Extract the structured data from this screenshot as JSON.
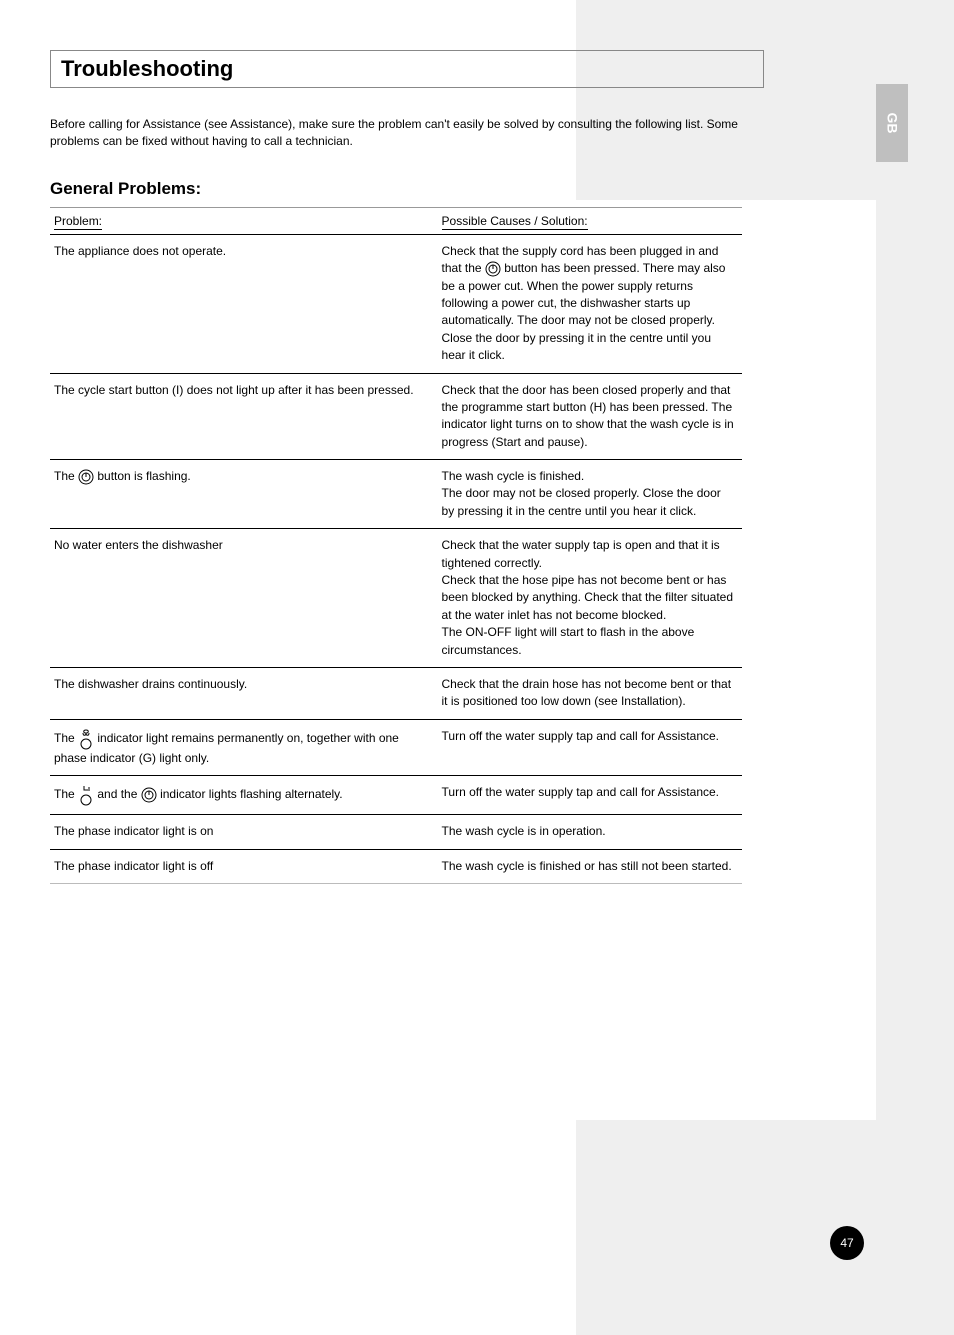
{
  "side_tab": "GB",
  "title": "Troubleshooting",
  "intro": "Before calling for Assistance (see Assistance), make sure the problem can't easily be solved by consulting the following list. Some problems can be fixed without having to call a technician.",
  "section_heading": "General Problems:",
  "headers": {
    "problem": "Problem:",
    "possible": "Possible Causes / Solution:"
  },
  "rows": [
    {
      "problem": "The appliance does not operate.",
      "solution_parts": [
        "Check that the supply cord has been plugged in and that the ",
        " button has been pressed. There may also be a power cut. When the power supply returns following a power cut, the dishwasher starts up automatically. The door may not be closed properly. Close the door by pressing it in the centre until you hear it click."
      ]
    },
    {
      "problem": "The cycle start button (I) does not light up after it has been pressed.",
      "solution": "Check that the door has been closed properly and that the programme start button (H) has been pressed. The indicator light turns on to show that the wash cycle is in progress (Start and pause)."
    },
    {
      "problem_parts": [
        "The ",
        " button is flashing."
      ],
      "solution": "The wash cycle is finished.\nThe door may not be closed properly. Close the door by pressing it in the centre until you hear it click."
    },
    {
      "problem": "No water enters the dishwasher",
      "solution": "Check that the water supply tap is open and that it is tightened correctly.\nCheck that the hose pipe has not become bent or has been blocked by anything. Check that the filter situated at the water inlet has not become blocked.\nThe ON-OFF light will start to flash in the above circumstances."
    },
    {
      "problem": "The dishwasher drains continuously.",
      "solution": "Check that the drain hose has not become bent or that it is positioned too low down (see Installation)."
    },
    {
      "problem_parts": [
        "The ",
        " indicator light remains permanently on, together with one phase indicator (G) light only."
      ],
      "solution": "Turn off the water supply tap and call for Assistance."
    },
    {
      "problem_parts": [
        "The ",
        " and the ",
        " indicator lights flashing alternately."
      ],
      "solution": "Turn off the water supply tap and call for Assistance."
    },
    {
      "problem": "The phase indicator light is on",
      "solution": "The wash cycle is in operation."
    },
    {
      "problem": "The phase indicator light is off",
      "solution": "The wash cycle is finished or has still not been started."
    }
  ],
  "page_number": "47"
}
